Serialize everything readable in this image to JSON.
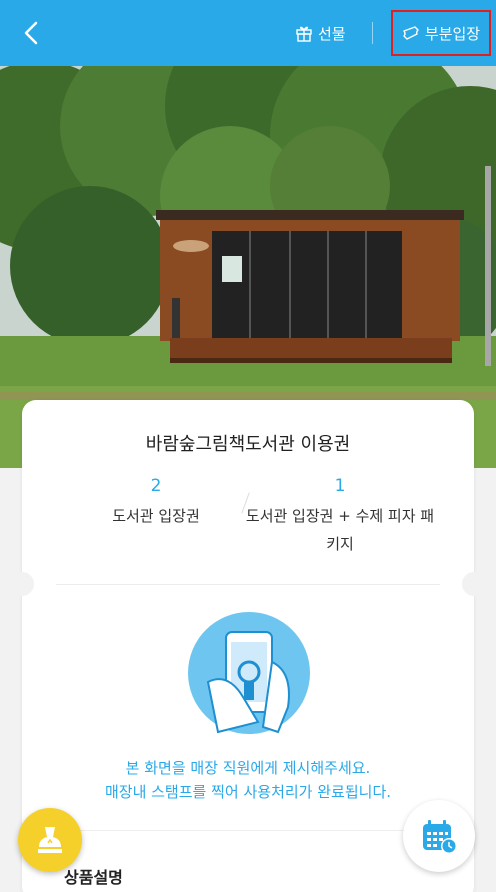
{
  "header": {
    "gift_label": "선물",
    "partial_entry_label": "부분입장",
    "accent_color": "#2aa9e8",
    "highlight_border_color": "#e0201f"
  },
  "ticket": {
    "title": "바람숲그림책도서관 이용권",
    "options": [
      {
        "count": "2",
        "label": "도서관 입장권"
      },
      {
        "count": "1",
        "label": "도서관 입장권 + 수제 피자 패키지"
      }
    ],
    "instruction_line1": "본 화면을 매장 직원에게 제시해주세요.",
    "instruction_line2": "매장내 스탬프를 찍어 사용처리가 완료됩니다."
  },
  "section": {
    "title": "상품설명"
  },
  "icons": {
    "back": "chevron-left-icon",
    "gift": "gift-icon",
    "ticket": "ticket-icon",
    "stamp": "stamp-icon",
    "calendar": "calendar-icon"
  }
}
